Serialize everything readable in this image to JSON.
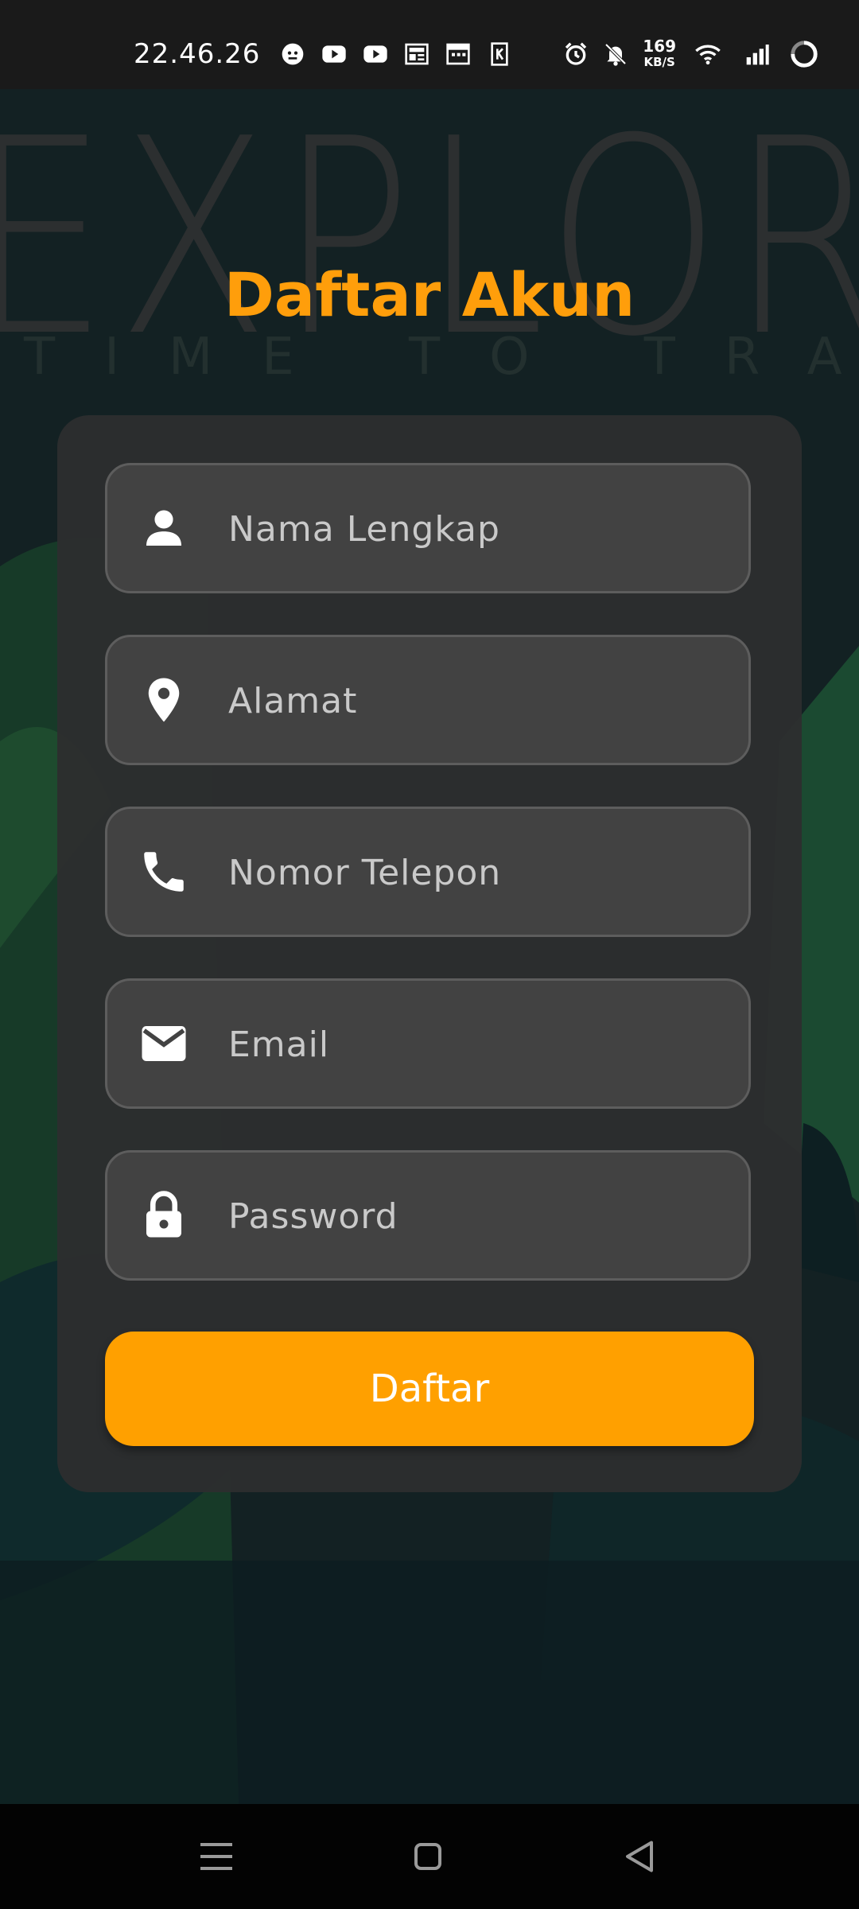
{
  "status_bar": {
    "time": "22.46.26",
    "net_speed_value": "169",
    "net_speed_unit": "KB/S",
    "icons_left": [
      "face-icon",
      "youtube-icon",
      "youtube-icon",
      "news-icon",
      "calendar-icon",
      "k-icon"
    ],
    "icons_right": [
      "alarm-icon",
      "notifications-off-icon",
      "wifi-icon",
      "signal-icon",
      "loading-icon"
    ]
  },
  "background": {
    "headline": "EXPLORE",
    "tagline": "TIME TO TRAVEL"
  },
  "title": "Daftar Akun",
  "form": {
    "fields": [
      {
        "placeholder": "Nama Lengkap",
        "icon": "person-icon"
      },
      {
        "placeholder": "Alamat",
        "icon": "location-pin-icon"
      },
      {
        "placeholder": "Nomor Telepon",
        "icon": "phone-icon"
      },
      {
        "placeholder": "Email",
        "icon": "mail-icon"
      },
      {
        "placeholder": "Password",
        "icon": "lock-icon"
      }
    ],
    "submit_label": "Daftar"
  },
  "colors": {
    "accent": "#ffa000",
    "title": "#ff9e0b",
    "card": "#2d2e2f",
    "field": "#424242"
  }
}
